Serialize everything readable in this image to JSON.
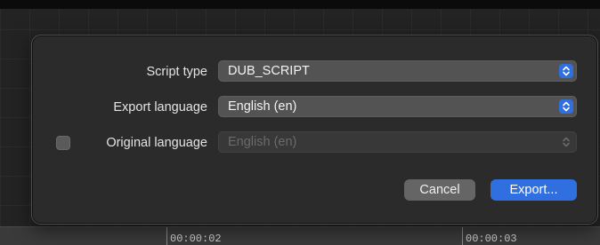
{
  "dialog": {
    "rows": [
      {
        "label": "Script type",
        "value": "DUB_SCRIPT",
        "enabled": true
      },
      {
        "label": "Export language",
        "value": "English (en)",
        "enabled": true
      },
      {
        "label": "Original language",
        "value": "English (en)",
        "enabled": false,
        "checked": false
      }
    ],
    "buttons": {
      "cancel": "Cancel",
      "export": "Export..."
    }
  },
  "timeline": {
    "markers": [
      "00:00:02",
      "00:00:03"
    ]
  },
  "colors": {
    "accent": "#2f6fe0",
    "dialog_bg": "#2b2b2b",
    "popup_bg": "#535353"
  },
  "icons": {
    "popup_indicator": "chevron-up-down-icon"
  }
}
